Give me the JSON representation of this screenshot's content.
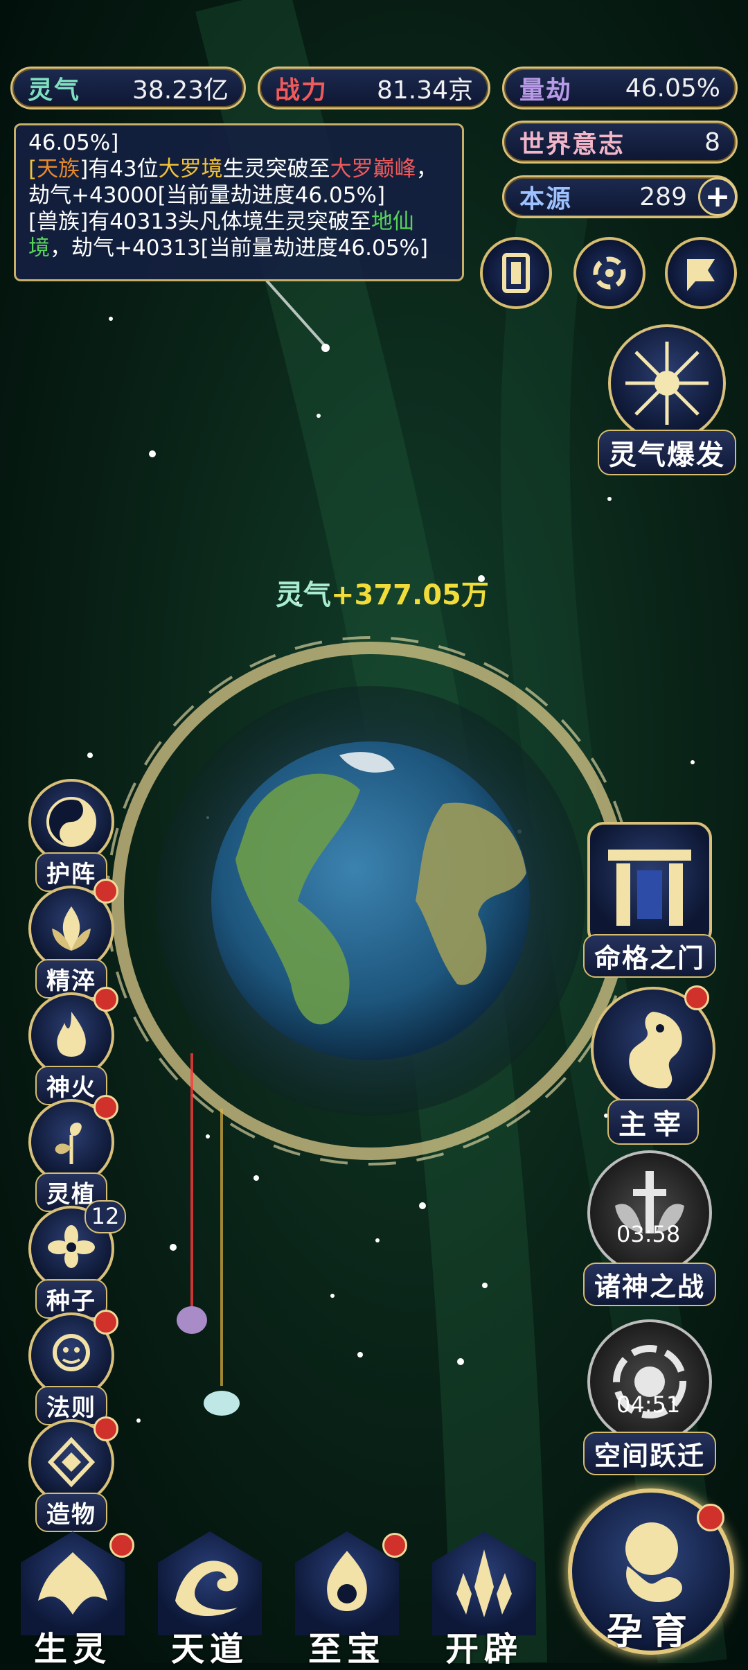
{
  "stats": {
    "lingqi": {
      "label": "灵气",
      "value": "38.23亿"
    },
    "zhanli": {
      "label": "战力",
      "value": "81.34京"
    },
    "liangjie": {
      "label": "量劫",
      "value": "46.05%"
    },
    "shijie": {
      "label": "世界意志",
      "value": "8"
    },
    "benyuan": {
      "label": "本源",
      "value": "289"
    }
  },
  "log": {
    "line0": "46.05%]",
    "e1": {
      "b1": "[",
      "race": "天族",
      "t1": "]有43位",
      "realm": "大罗境",
      "t2": "生灵突破至",
      "target": "大罗巅峰",
      "t3": "，劫气+43000[当前量劫进度46.05%]"
    },
    "e2": {
      "t1": "[兽族]有40313头凡体境生灵突破至",
      "target": "地仙境",
      "t2": "，劫气+40313[当前量劫进度46.05%]"
    }
  },
  "floating_text": {
    "label": "灵气",
    "value": "+377.05万"
  },
  "left_menu": [
    {
      "label": "护阵",
      "icon": "yin-yang-icon"
    },
    {
      "label": "精淬",
      "icon": "flame-lotus-icon",
      "badge": true
    },
    {
      "label": "神火",
      "icon": "fire-icon",
      "badge": true
    },
    {
      "label": "灵植",
      "icon": "leaf-plant-icon",
      "badge": true
    },
    {
      "label": "种子",
      "icon": "seed-flower-icon",
      "count": "12"
    },
    {
      "label": "法则",
      "icon": "rune-icon",
      "badge": true
    },
    {
      "label": "造物",
      "icon": "diamond-icon",
      "badge": true
    }
  ],
  "right_menu": {
    "burst": "灵气爆发",
    "fate_gate": "命格之门",
    "master": "主宰",
    "gods_war": {
      "label": "诸神之战",
      "timer": "03:58"
    },
    "space_jump": {
      "label": "空间跃迁",
      "timer": "04:51"
    }
  },
  "bottom_nav": [
    {
      "label": "生灵",
      "badge": true
    },
    {
      "label": "天道",
      "badge": false
    },
    {
      "label": "至宝",
      "badge": true
    },
    {
      "label": "开辟",
      "badge": false
    }
  ],
  "main_action": "孕育",
  "colors": {
    "gold": "#d8c07a",
    "lingqi": "#7fe0c0",
    "zhanli": "#ef5a5a",
    "badge": "#d0312a"
  }
}
